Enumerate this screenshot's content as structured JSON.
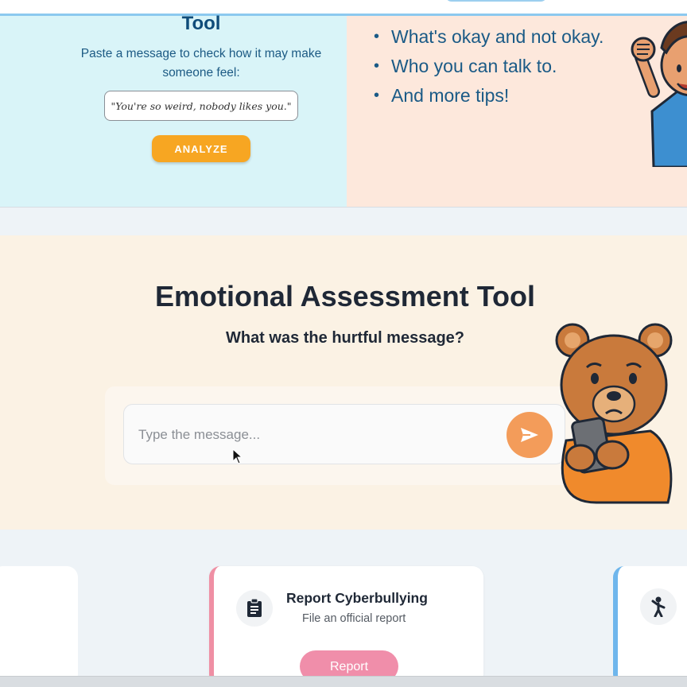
{
  "tool_panel": {
    "title": "Tool",
    "description": "Paste a message to check how it may make someone feel:",
    "sample_message": "\"You're so weird, nobody likes you.\"",
    "analyze_label": "ANALYZE"
  },
  "tips_panel": {
    "items": [
      {
        "text": "What's okay and not okay."
      },
      {
        "text": "Who you can talk to."
      },
      {
        "text": "And more tips!"
      }
    ]
  },
  "assessment": {
    "title": "Emotional Assessment Tool",
    "question": "What was the hurtful message?",
    "input_placeholder": "Type the message...",
    "send_icon": "send-icon"
  },
  "cards": {
    "report": {
      "title": "Report Cyberbullying",
      "description": "File an official report",
      "button_label": "Report",
      "icon": "clipboard-icon",
      "accent": "#ef8fa4"
    },
    "right_card": {
      "icon": "person-icon",
      "accent": "#6fb6ec"
    }
  },
  "colors": {
    "analyze_button": "#f7a622",
    "send_button": "#f39c5a",
    "report_button": "#f08eaa",
    "heading": "#1f2836",
    "tips_text": "#1a5a86"
  }
}
